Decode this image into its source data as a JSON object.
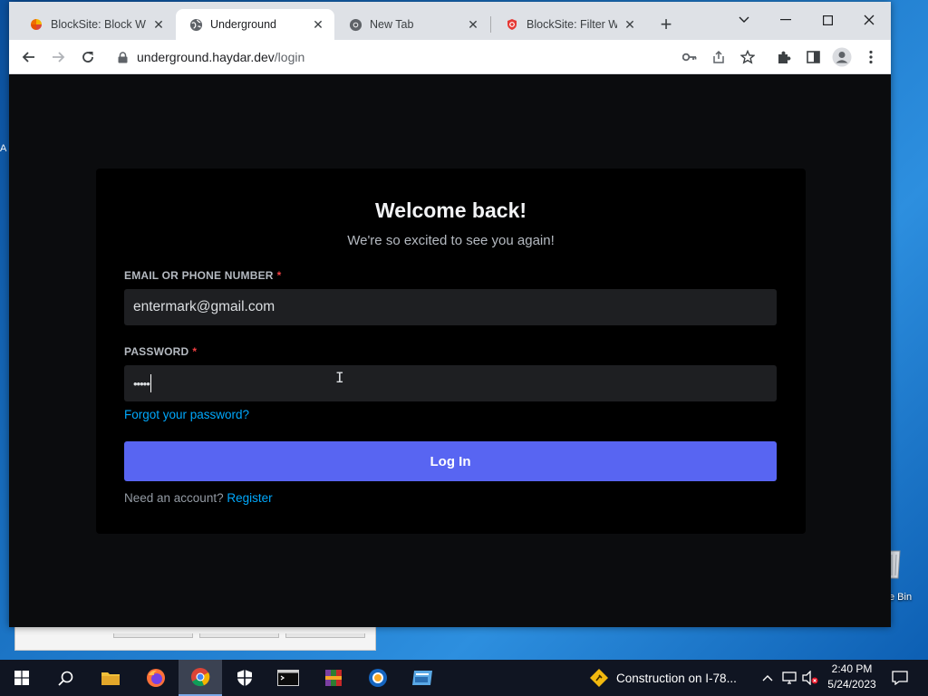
{
  "browser": {
    "tabs": [
      {
        "title": "BlockSite: Block Web",
        "icon": "blocksite-icon"
      },
      {
        "title": "Underground",
        "icon": "globe-icon",
        "active": true
      },
      {
        "title": "New Tab",
        "icon": "chrome-icon"
      },
      {
        "title": "BlockSite: Filter Web",
        "icon": "shield-icon"
      }
    ],
    "new_tab": "+",
    "url_host": "underground.haydar.dev",
    "url_path": "/login"
  },
  "login": {
    "title": "Welcome back!",
    "subtitle": "We're so excited to see you again!",
    "email_label": "EMAIL OR PHONE NUMBER",
    "required_mark": "*",
    "email_value": "entermark@gmail.com",
    "password_label": "PASSWORD",
    "password_value": "•••••",
    "forgot_link": "Forgot your password?",
    "login_button": "Log In",
    "need_account": "Need an account?",
    "register_link": "Register"
  },
  "desktop": {
    "recycle_label": "e Bin",
    "edge_text": "A"
  },
  "taskbar": {
    "news_text": "Construction on I-78...",
    "time": "2:40 PM",
    "date": "5/24/2023"
  },
  "colors": {
    "accent": "#5865f2",
    "link": "#00a8fc",
    "required": "#f23f42",
    "card_bg": "#000000",
    "page_bg": "#0b0c0e"
  }
}
